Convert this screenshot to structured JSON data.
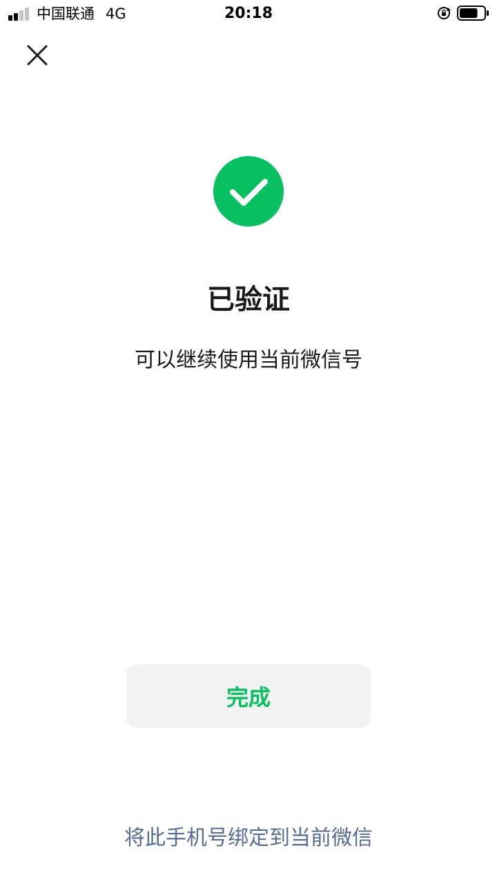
{
  "status_bar": {
    "carrier": "中国联通",
    "network": "4G",
    "time": "20:18",
    "signal_bars": 2,
    "signal_total": 4,
    "battery_level": 0.75
  },
  "header": {
    "close_icon": "close-icon"
  },
  "result": {
    "icon": "check-circle-icon",
    "title": "已验证",
    "subtitle": "可以继续使用当前微信号"
  },
  "actions": {
    "done_label": "完成",
    "bind_link_label": "将此手机号绑定到当前微信"
  },
  "colors": {
    "brand_green": "#07c160",
    "link_blue": "#576b95",
    "text_primary": "#191919",
    "button_bg": "#f2f2f2"
  }
}
